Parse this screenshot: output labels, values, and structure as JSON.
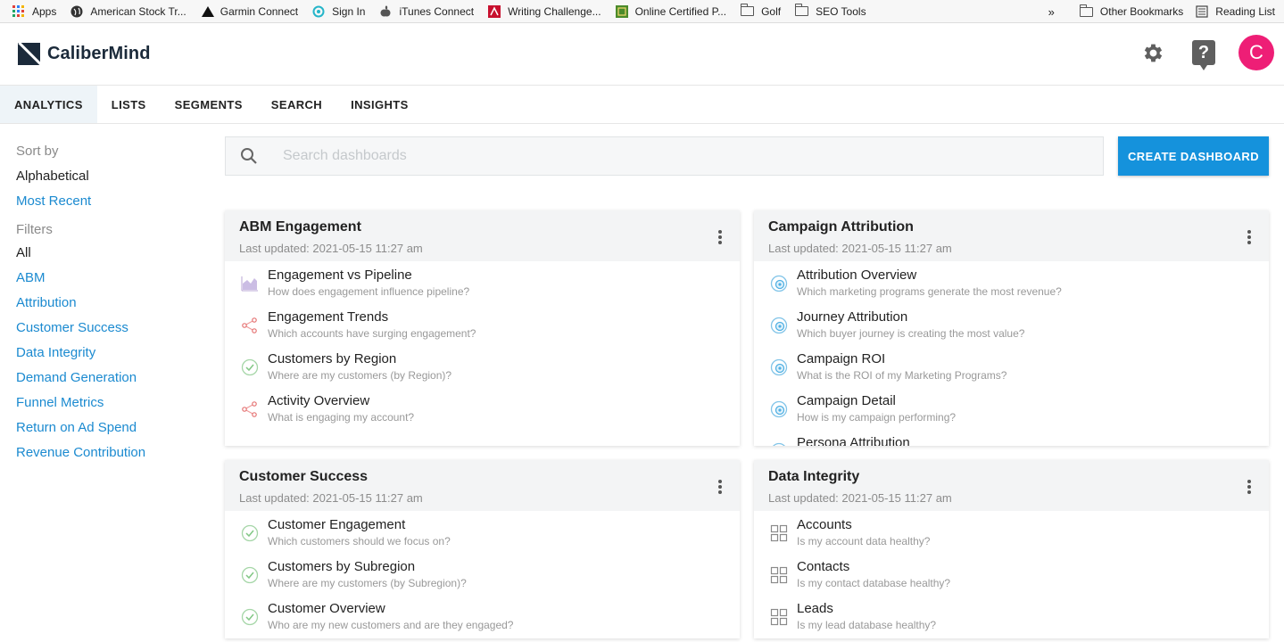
{
  "bookmarks": {
    "items": [
      {
        "label": "Apps",
        "icon": "apps-grid-icon"
      },
      {
        "label": "American Stock Tr...",
        "icon": "globe-icon"
      },
      {
        "label": "Garmin Connect",
        "icon": "triangle-icon"
      },
      {
        "label": "Sign In",
        "icon": "swirl-icon"
      },
      {
        "label": "iTunes Connect",
        "icon": "apple-icon"
      },
      {
        "label": "Writing Challenge...",
        "icon": "red-logo-icon"
      },
      {
        "label": "Online Certified P...",
        "icon": "green-logo-icon"
      },
      {
        "label": "Golf",
        "icon": "folder-icon"
      },
      {
        "label": "SEO Tools",
        "icon": "folder-icon"
      }
    ],
    "overflow": "»",
    "other": "Other Bookmarks",
    "reading_list": "Reading List"
  },
  "header": {
    "brand": "CaliberMind",
    "help_glyph": "?",
    "avatar_initial": "C",
    "avatar_color": "#ee1e76"
  },
  "nav": {
    "tabs": [
      "ANALYTICS",
      "LISTS",
      "SEGMENTS",
      "SEARCH",
      "INSIGHTS"
    ]
  },
  "sidebar": {
    "sort_heading": "Sort by",
    "sort_options": [
      "Alphabetical",
      "Most Recent"
    ],
    "filters_heading": "Filters",
    "filters": [
      "All",
      "ABM",
      "Attribution",
      "Customer Success",
      "Data Integrity",
      "Demand Generation",
      "Funnel Metrics",
      "Return on Ad Spend",
      "Revenue Contribution"
    ]
  },
  "search": {
    "placeholder": "Search dashboards"
  },
  "create_button": "CREATE DASHBOARD",
  "accent_color": "#1592dc",
  "cards": [
    {
      "title": "ABM Engagement",
      "updated": "Last updated: 2021-05-15 11:27 am",
      "items": [
        {
          "title": "Engagement vs Pipeline",
          "desc": "How does engagement influence pipeline?",
          "icon": "area-chart-icon"
        },
        {
          "title": "Engagement Trends",
          "desc": "Which accounts have surging engagement?",
          "icon": "network-icon"
        },
        {
          "title": "Customers by Region",
          "desc": "Where are my customers (by Region)?",
          "icon": "check-circle-icon"
        },
        {
          "title": "Activity Overview",
          "desc": "What is engaging my account?",
          "icon": "network-icon"
        }
      ]
    },
    {
      "title": "Campaign Attribution",
      "updated": "Last updated: 2021-05-15 11:27 am",
      "items": [
        {
          "title": "Attribution Overview",
          "desc": "Which marketing programs generate the most revenue?",
          "icon": "target-icon"
        },
        {
          "title": "Journey Attribution",
          "desc": "Which buyer journey is creating the most value?",
          "icon": "target-icon"
        },
        {
          "title": "Campaign ROI",
          "desc": "What is the ROI of my Marketing Programs?",
          "icon": "target-icon"
        },
        {
          "title": "Campaign Detail",
          "desc": "How is my campaign performing?",
          "icon": "target-icon"
        },
        {
          "title": "Persona Attribution",
          "desc": "",
          "icon": "target-icon"
        }
      ]
    },
    {
      "title": "Customer Success",
      "updated": "Last updated: 2021-05-15 11:27 am",
      "items": [
        {
          "title": "Customer Engagement",
          "desc": "Which customers should we focus on?",
          "icon": "check-circle-icon"
        },
        {
          "title": "Customers by Subregion",
          "desc": "Where are my customers (by Subregion)?",
          "icon": "check-circle-icon"
        },
        {
          "title": "Customer Overview",
          "desc": "Who are my new customers and are they engaged?",
          "icon": "check-circle-icon"
        }
      ]
    },
    {
      "title": "Data Integrity",
      "updated": "Last updated: 2021-05-15 11:27 am",
      "items": [
        {
          "title": "Accounts",
          "desc": "Is my account data healthy?",
          "icon": "grid-icon"
        },
        {
          "title": "Contacts",
          "desc": "Is my contact database healthy?",
          "icon": "grid-icon"
        },
        {
          "title": "Leads",
          "desc": "Is my lead database healthy?",
          "icon": "grid-icon"
        }
      ]
    }
  ]
}
